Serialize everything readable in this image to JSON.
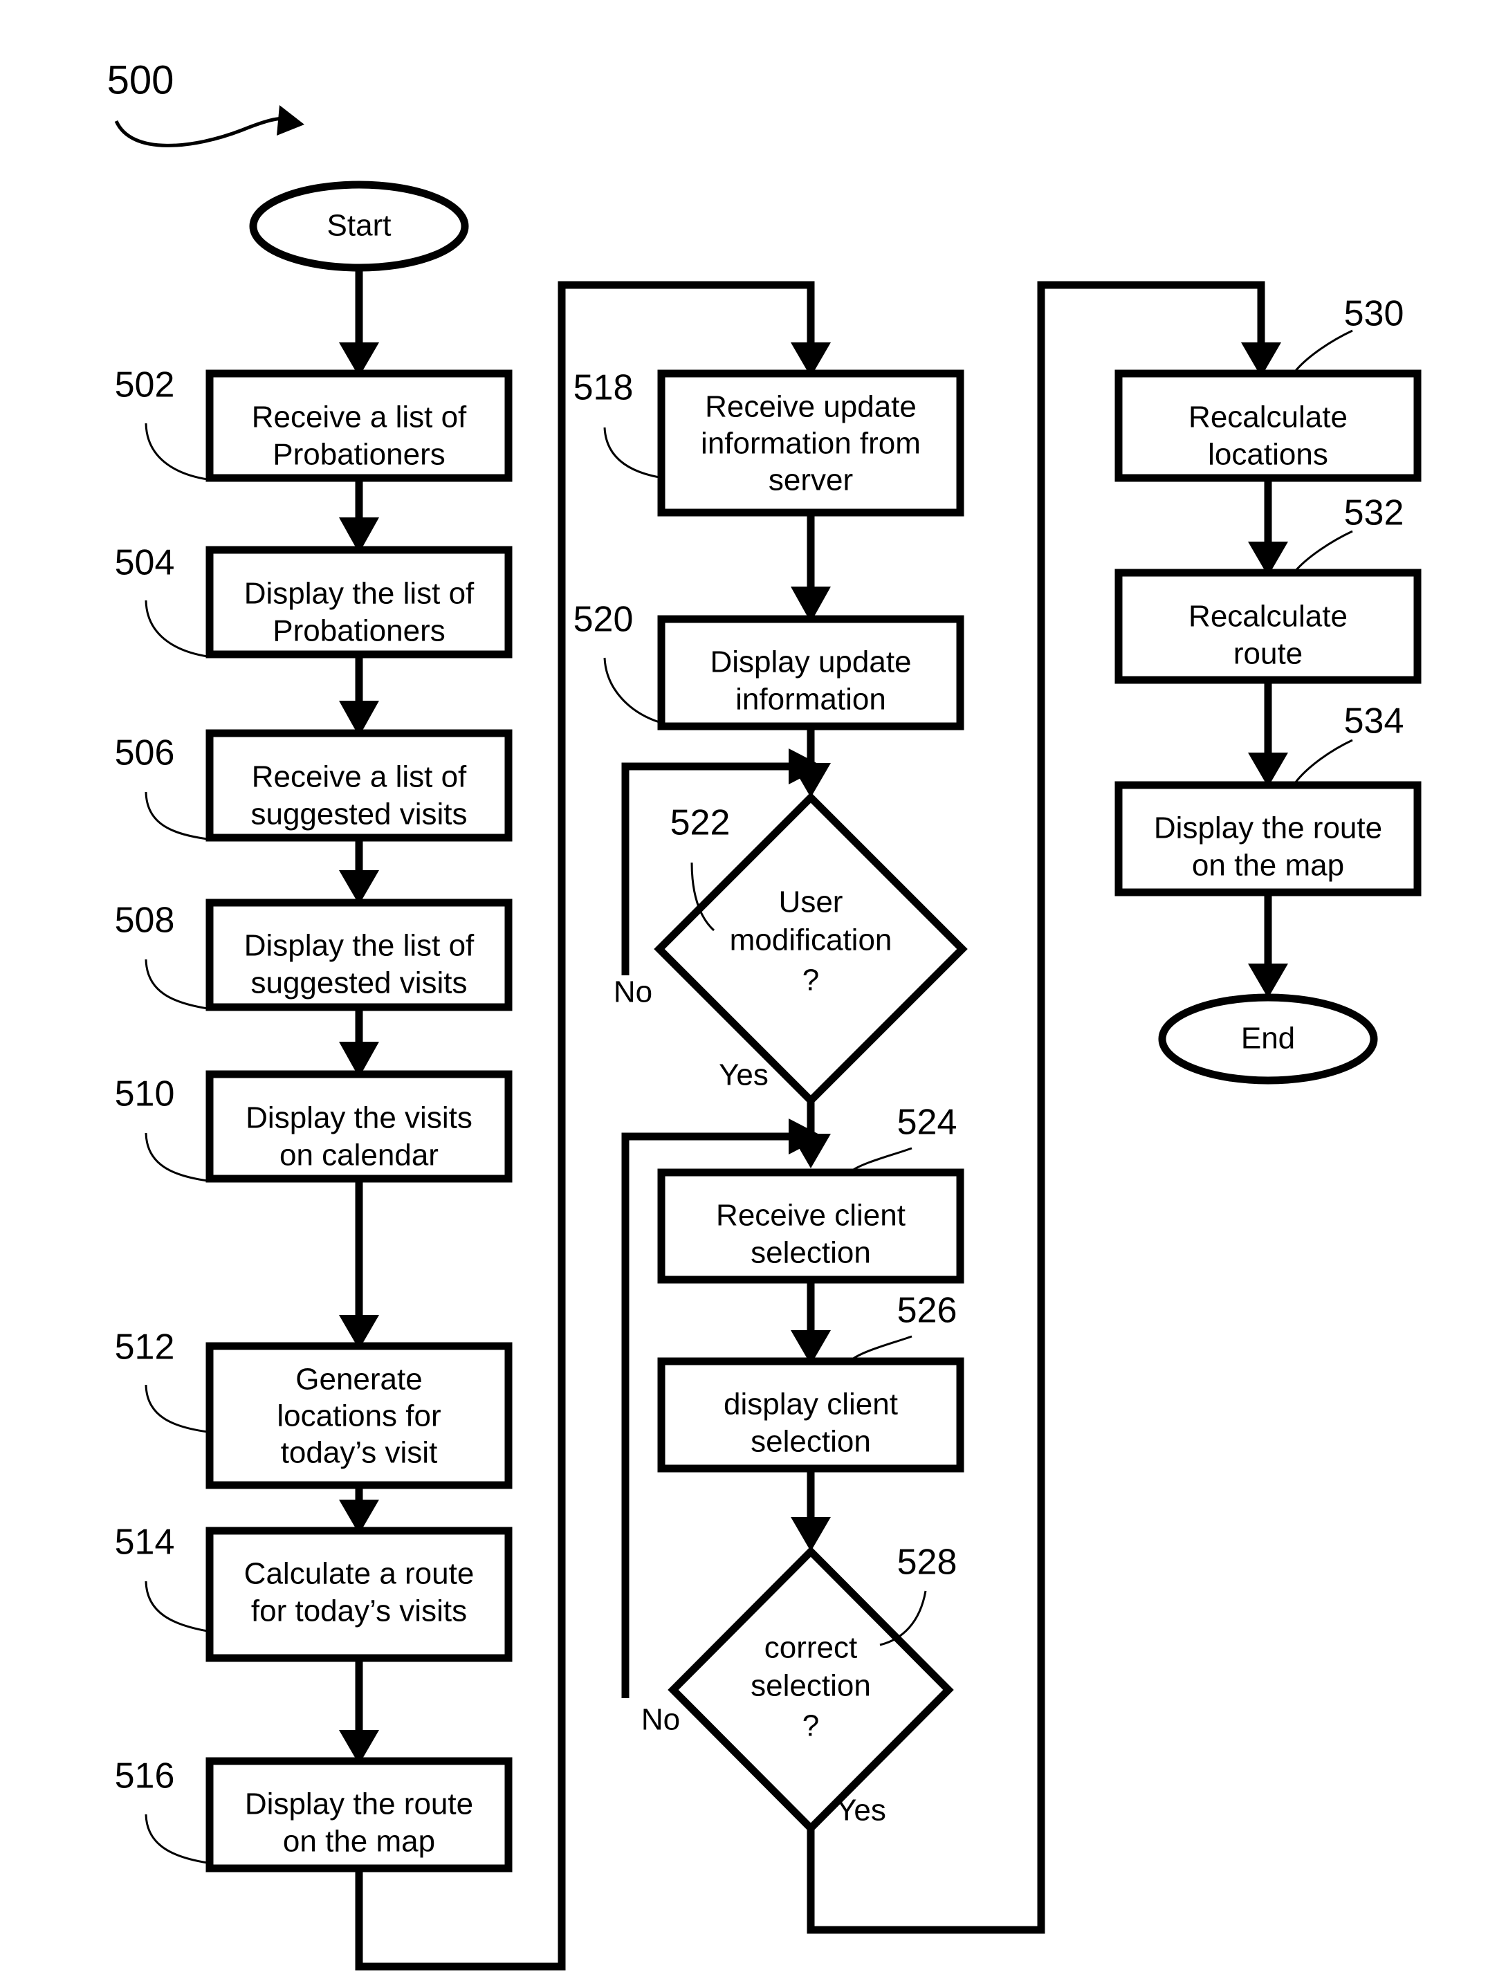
{
  "figure": {
    "number": "500"
  },
  "terminals": {
    "start": "Start",
    "end": "End"
  },
  "branches": {
    "no": "No",
    "yes": "Yes"
  },
  "column1": {
    "nodes": [
      {
        "ref": "502",
        "line1": "Receive a list of",
        "line2": "Probationers",
        "line3": ""
      },
      {
        "ref": "504",
        "line1": "Display the list of",
        "line2": "Probationers",
        "line3": ""
      },
      {
        "ref": "506",
        "line1": "Receive a list of",
        "line2": "suggested visits",
        "line3": ""
      },
      {
        "ref": "508",
        "line1": "Display the list of",
        "line2": "suggested visits",
        "line3": ""
      },
      {
        "ref": "510",
        "line1": "Display the visits",
        "line2": "on calendar",
        "line3": ""
      },
      {
        "ref": "512",
        "line1": "Generate",
        "line2": "locations for",
        "line3": "today’s visit"
      },
      {
        "ref": "514",
        "line1": "Calculate a route",
        "line2": "for today’s visits",
        "line3": ""
      },
      {
        "ref": "516",
        "line1": "Display the route",
        "line2": "on the map",
        "line3": ""
      }
    ]
  },
  "column2": {
    "nodes": [
      {
        "ref": "518",
        "line1": "Receive update",
        "line2": "information from",
        "line3": "server"
      },
      {
        "ref": "520",
        "line1": "Display update",
        "line2": "information",
        "line3": ""
      },
      {
        "ref": "524",
        "line1": "Receive client",
        "line2": "selection",
        "line3": ""
      },
      {
        "ref": "526",
        "line1": "display client",
        "line2": "selection",
        "line3": ""
      }
    ],
    "decisions": [
      {
        "ref": "522",
        "line1": "User",
        "line2": "modification",
        "line3": "?",
        "no_label": "No",
        "yes_label": "Yes"
      },
      {
        "ref": "528",
        "line1": "correct",
        "line2": "selection",
        "line3": "?",
        "no_label": "No",
        "yes_label": "Yes"
      }
    ]
  },
  "column3": {
    "nodes": [
      {
        "ref": "530",
        "line1": "Recalculate",
        "line2": "locations",
        "line3": ""
      },
      {
        "ref": "532",
        "line1": "Recalculate",
        "line2": "route",
        "line3": ""
      },
      {
        "ref": "534",
        "line1": "Display the route",
        "line2": "on the map",
        "line3": ""
      }
    ]
  },
  "colors": {
    "stroke": "#000000",
    "fill": "#ffffff",
    "text": "#000000"
  }
}
